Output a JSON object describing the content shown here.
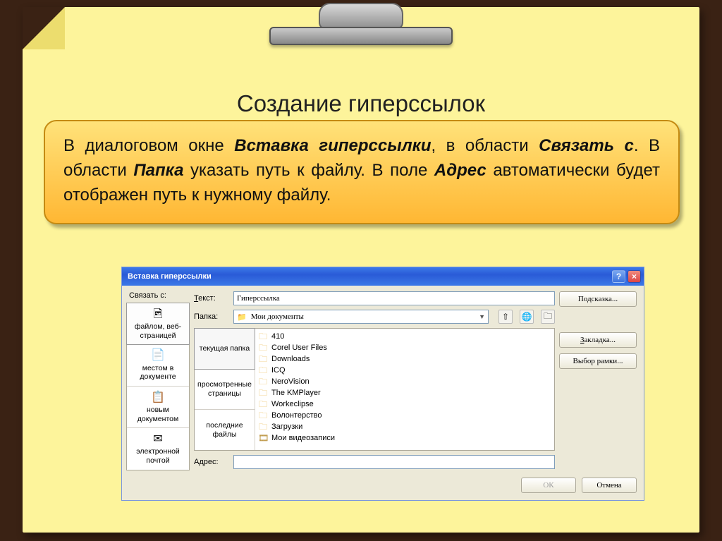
{
  "heading": "Создание гиперссылок",
  "callout": {
    "part1": "В диалоговом окне ",
    "b1": "Вставка гиперссылки",
    "part2": ", в области ",
    "b2": "Связать с",
    "part3": ". В области ",
    "b3": "Папка",
    "part4": " указать путь к файлу. В поле ",
    "b4": "Адрес",
    "part5": " автоматически будет отображен путь к нужному файлу."
  },
  "dialog": {
    "title": "Вставка гиперссылки",
    "linkWithLabel": "Связать с:",
    "tabs": [
      {
        "label": "файлом, веб-страницей",
        "icon": "🖻"
      },
      {
        "label": "местом в документе",
        "icon": "📄"
      },
      {
        "label": "новым документом",
        "icon": "📋"
      },
      {
        "label": "электронной почтой",
        "icon": "✉"
      }
    ],
    "textLabel": "Текст:",
    "textValue": "Гиперссылка",
    "folderLabel": "Папка:",
    "folderSelected": "Мои документы",
    "viewTabs": [
      "текущая папка",
      "просмотренные страницы",
      "последние файлы"
    ],
    "files": [
      {
        "name": "410",
        "type": "folder"
      },
      {
        "name": "Corel User Files",
        "type": "folder"
      },
      {
        "name": "Downloads",
        "type": "folder"
      },
      {
        "name": "ICQ",
        "type": "folder"
      },
      {
        "name": "NeroVision",
        "type": "folder"
      },
      {
        "name": "The KMPlayer",
        "type": "folder"
      },
      {
        "name": "Workeclipse",
        "type": "folder"
      },
      {
        "name": "Волонтерство",
        "type": "folder"
      },
      {
        "name": "Загрузки",
        "type": "folder"
      },
      {
        "name": "Мои видеозаписи",
        "type": "video"
      }
    ],
    "addressLabel": "Адрес:",
    "addressValue": "",
    "buttons": {
      "hint": "Подсказка...",
      "bookmark": "Закладка...",
      "frame": "Выбор рамки...",
      "ok": "ОК",
      "cancel": "Отмена"
    }
  }
}
